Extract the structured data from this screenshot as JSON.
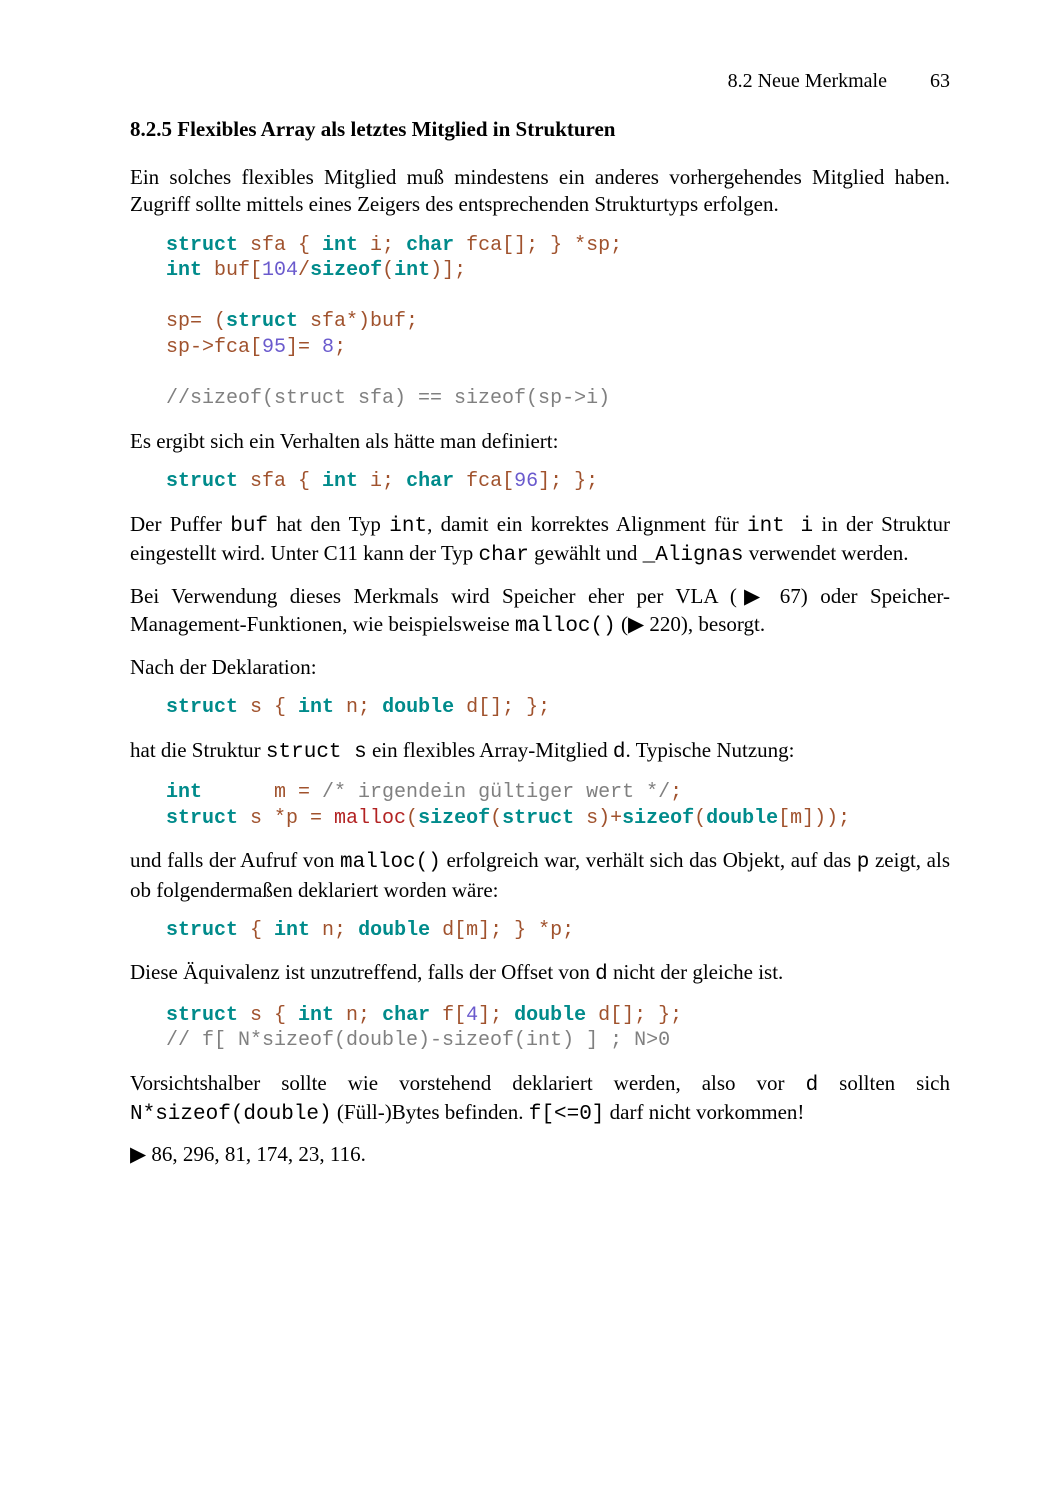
{
  "header": {
    "section": "8.2  Neue Merkmale",
    "page": "63"
  },
  "heading": "8.2.5  Flexibles Array als letztes Mitglied in Strukturen",
  "p1": "Ein solches flexibles Mitglied muß mindestens ein anderes vorhergehendes Mitglied haben. Zugriff sollte mittels eines Zeigers des entsprechenden Strukturtyps erfolgen.",
  "code1": {
    "l1a": "struct",
    "l1b": " sfa { ",
    "l1c": "int",
    "l1d": " i; ",
    "l1e": "char",
    "l1f": " fca[]; } *sp;",
    "l2a": "int",
    "l2b": " buf[",
    "l2c": "104",
    "l2d": "/",
    "l2e": "sizeof",
    "l2f": "(",
    "l2g": "int",
    "l2h": ")];",
    "l3": "",
    "l4a": "sp= (",
    "l4b": "struct",
    "l4c": " sfa*)buf;",
    "l5a": "sp->fca[",
    "l5b": "95",
    "l5c": "]= ",
    "l5d": "8",
    "l5e": ";",
    "l6": "",
    "l7": "//sizeof(struct sfa) == sizeof(sp->i)"
  },
  "p2": "Es ergibt sich ein Verhalten als hätte man definiert:",
  "code2": {
    "a": "struct",
    "b": " sfa { ",
    "c": "int",
    "d": " i; ",
    "e": "char",
    "f": " fca[",
    "g": "96",
    "h": "]; };"
  },
  "p3_parts": {
    "a": "Der Puffer ",
    "b": "buf",
    "c": " hat den Typ ",
    "d": "int",
    "e": ", damit ein korrektes Alignment für ",
    "f": "int i",
    "g": " in der Struktur eingestellt wird.  Unter C11 kann der Typ ",
    "h": "char",
    "i": " gewählt und ",
    "j": "_Alignas",
    "k": " verwendet werden."
  },
  "p4_parts": {
    "a": "Bei Verwendung dieses Merkmals wird Speicher eher per VLA (",
    "tri": "▶",
    "r1": " 67) oder Spei­cher-Management-Funktionen, wie beispielsweise ",
    "m": "malloc()",
    "b": " (",
    "r2": " 220), besorgt."
  },
  "p5": "Nach der Deklaration:",
  "code3": {
    "a": "struct",
    "b": " s { ",
    "c": "int",
    "d": " n; ",
    "e": "double",
    "f": " d[]; };"
  },
  "p6_parts": {
    "a": "hat die Struktur ",
    "b": "struct s",
    "c": " ein flexibles Array-Mitglied ",
    "d": "d",
    "e": ". Typische Nutzung:"
  },
  "code4": {
    "l1a": "int",
    "l1b": "      m = ",
    "l1c": "/* irgendein gültiger wert */",
    "l1d": ";",
    "l2a": "struct",
    "l2b": " s *p = ",
    "l2c": "malloc",
    "l2d": "(",
    "l2e": "sizeof",
    "l2f": "(",
    "l2g": "struct",
    "l2h": " s)+",
    "l2i": "sizeof",
    "l2j": "(",
    "l2k": "double",
    "l2l": "[m]));"
  },
  "p7_parts": {
    "a": "und falls der Aufruf von ",
    "b": "malloc()",
    "c": " erfolgreich war, verhält sich das Objekt, auf das ",
    "d": "p",
    "e": " zeigt, als ob folgendermaßen deklariert worden wäre:"
  },
  "code5": {
    "a": "struct",
    "b": " { ",
    "c": "int",
    "d": " n; ",
    "e": "double",
    "f": " d[m]; } *p;"
  },
  "p8_parts": {
    "a": "Diese Äquivalenz ist unzutreffend, falls der Offset von ",
    "b": "d",
    "c": " nicht der gleiche ist."
  },
  "code6": {
    "l1a": "struct",
    "l1b": " s { ",
    "l1c": "int",
    "l1d": " n; ",
    "l1e": "char",
    "l1f": " f[",
    "l1g": "4",
    "l1h": "]; ",
    "l1i": "double",
    "l1j": " d[]; };",
    "l2": "// f[ N*sizeof(double)-sizeof(int) ] ; N>0"
  },
  "p9_parts": {
    "a": "Vorsichtshalber sollte wie vorstehend deklariert werden, also vor ",
    "b": "d",
    "c": " sollten sich ",
    "d": "N*sizeof(double)",
    "e": " (Füll-)Bytes befinden. ",
    "f": "f[<=0]",
    "g": " darf nicht vorkommen!"
  },
  "refs": " 86, 296, 81, 174, 23, 116.",
  "tri": "▶"
}
